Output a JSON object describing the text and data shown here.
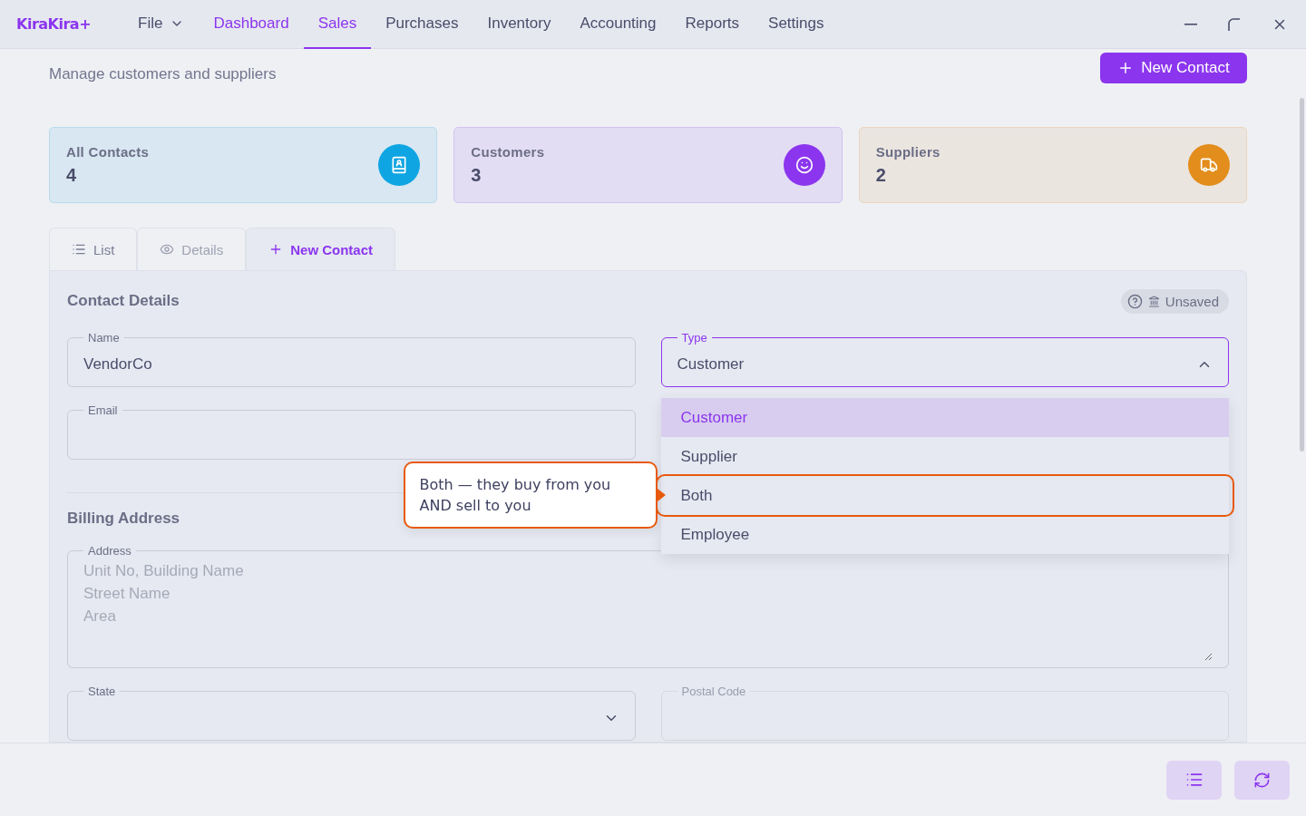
{
  "app": {
    "logo": "KiraKira+"
  },
  "nav": [
    {
      "label": "File",
      "kind": "menu",
      "selected": false,
      "highlighted": false
    },
    {
      "label": "Dashboard",
      "kind": "link",
      "selected": false,
      "highlighted": true
    },
    {
      "label": "Sales",
      "kind": "link",
      "selected": true,
      "highlighted": true
    },
    {
      "label": "Purchases",
      "kind": "link",
      "selected": false,
      "highlighted": false
    },
    {
      "label": "Inventory",
      "kind": "link",
      "selected": false,
      "highlighted": false
    },
    {
      "label": "Accounting",
      "kind": "link",
      "selected": false,
      "highlighted": false
    },
    {
      "label": "Reports",
      "kind": "link",
      "selected": false,
      "highlighted": false
    },
    {
      "label": "Settings",
      "kind": "link",
      "selected": false,
      "highlighted": false
    }
  ],
  "page": {
    "new_button": "New Contact",
    "subtitle": "Manage customers and suppliers"
  },
  "stats": [
    {
      "label": "All Contacts",
      "value": "4",
      "kind": "contacts",
      "color": "#0ea5e2"
    },
    {
      "label": "Customers",
      "value": "3",
      "kind": "customers",
      "color": "#8b35ee"
    },
    {
      "label": "Suppliers",
      "value": "2",
      "kind": "suppliers",
      "color": "#e28d1c"
    }
  ],
  "tabs": [
    {
      "label": "List",
      "kind": "list",
      "selected": false,
      "disabled": false
    },
    {
      "label": "Details",
      "kind": "details",
      "selected": false,
      "disabled": true
    },
    {
      "label": "New Contact",
      "kind": "new",
      "selected": true,
      "disabled": false
    }
  ],
  "form": {
    "title": "Contact Details",
    "status": "Unsaved",
    "name": {
      "label": "Name",
      "value": "VendorCo"
    },
    "type": {
      "label": "Type",
      "value": "Customer",
      "expanded": true,
      "options": [
        {
          "label": "Customer",
          "selected": true,
          "focused": false
        },
        {
          "label": "Supplier",
          "selected": false,
          "focused": false
        },
        {
          "label": "Both",
          "selected": false,
          "focused": true
        },
        {
          "label": "Employee",
          "selected": false,
          "focused": false
        }
      ]
    },
    "email": {
      "label": "Email"
    },
    "billing_title": "Billing Address",
    "address": {
      "label": "Address",
      "placeholder": "Unit No, Building Name\nStreet Name\nArea"
    },
    "state": {
      "label": "State"
    },
    "postal_code": {
      "label": "Postal Code",
      "disabled": true
    },
    "tooltip": "Both — they buy from you AND sell to you"
  }
}
